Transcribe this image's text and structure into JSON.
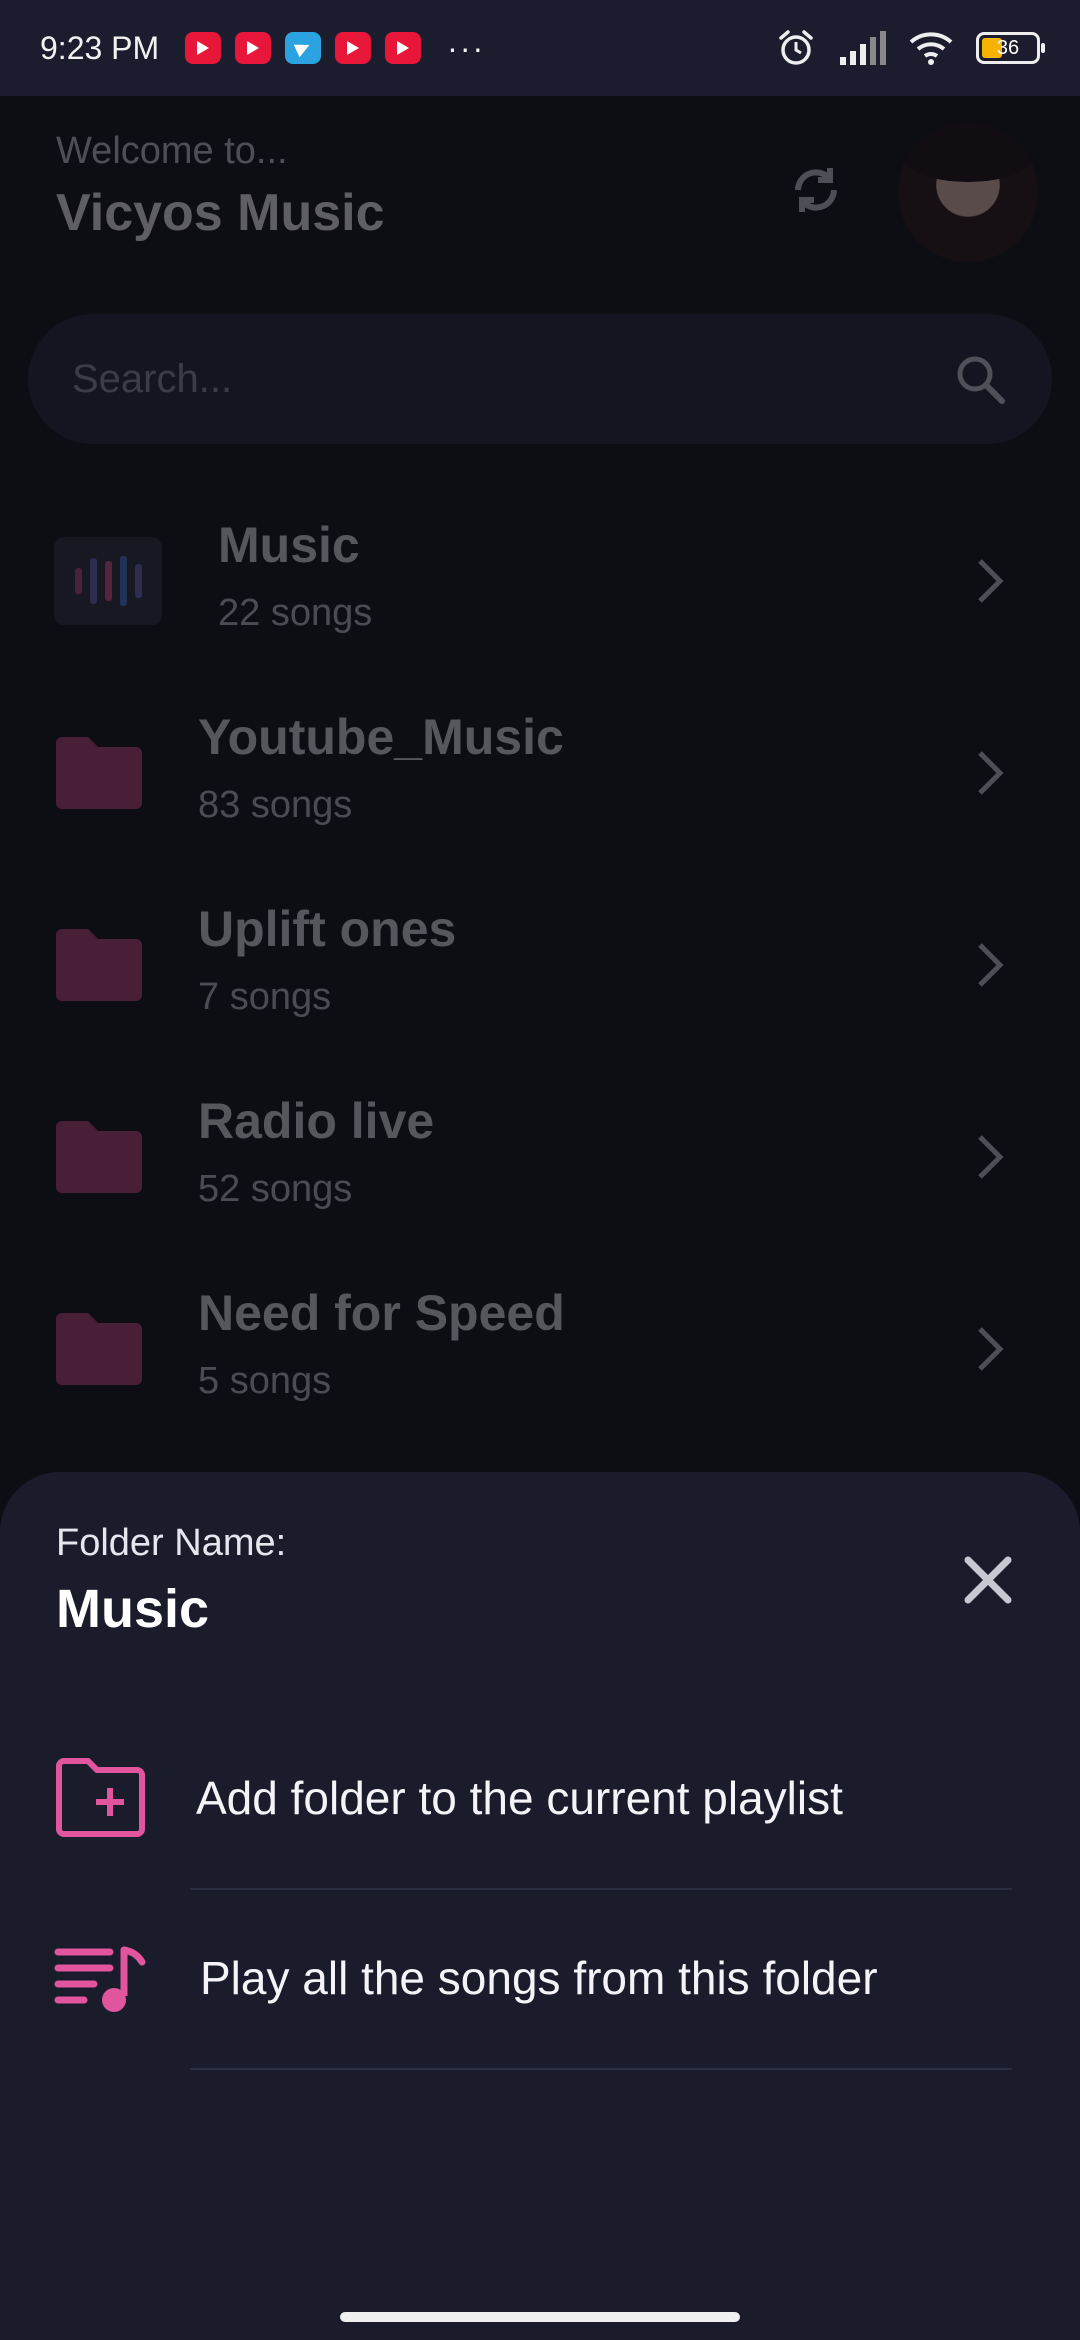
{
  "status_bar": {
    "time": "9:23 PM",
    "notifications": [
      "youtube-icon",
      "youtube-icon",
      "telegram-icon",
      "youtube-icon",
      "youtube-icon"
    ],
    "more": "···",
    "battery": "36"
  },
  "header": {
    "welcome": "Welcome to...",
    "app_name": "Vicyos Music"
  },
  "search": {
    "placeholder": "Search..."
  },
  "folders": [
    {
      "name": "Music",
      "count": "22 songs"
    },
    {
      "name": "Youtube_Music",
      "count": "83 songs"
    },
    {
      "name": "Uplift ones",
      "count": "7 songs"
    },
    {
      "name": "Radio live",
      "count": "52 songs"
    },
    {
      "name": "Need for Speed",
      "count": "5 songs"
    }
  ],
  "sheet": {
    "label": "Folder Name:",
    "folder_name": "Music",
    "actions": [
      {
        "label": "Add folder to the current playlist",
        "icon": "folder-add-icon"
      },
      {
        "label": "Play all the songs from this folder",
        "icon": "playlist-play-icon"
      }
    ]
  },
  "colors": {
    "accent": "#e0559e",
    "folder": "#c0457f",
    "background": "#0d0d14",
    "sheet": "#1a1c2c"
  }
}
